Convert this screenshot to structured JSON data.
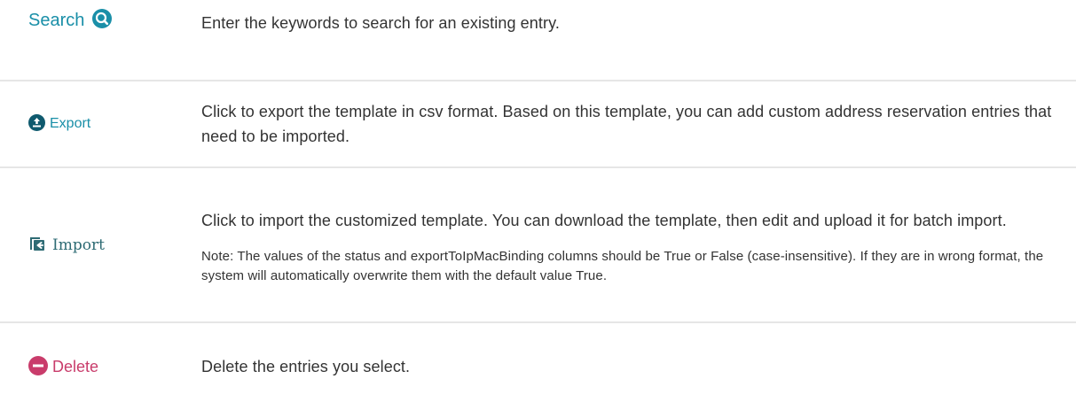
{
  "rows": [
    {
      "control_label": "Search",
      "icon": "search-icon",
      "description": "Enter the keywords to search for an existing entry."
    },
    {
      "control_label": "Export",
      "icon": "export-icon",
      "description": "Click to export the template in csv format. Based on this template, you can add custom address reservation entries that need to be imported."
    },
    {
      "control_label": "Import",
      "icon": "import-icon",
      "description": "Click to import the customized template. You can download the template, then edit and upload it for batch import.",
      "note": "Note: The values of the status and exportToIpMacBinding columns should be True or False (case-insensitive). If they are in wrong format, the system will automatically overwrite them with the default value True."
    },
    {
      "control_label": "Delete",
      "icon": "delete-icon",
      "description": "Delete the entries you select."
    }
  ],
  "colors": {
    "search": "#1a8fa8",
    "export_icon": "#0f5a6e",
    "import_icon": "#2e6b74",
    "delete": "#c93c6b",
    "divider": "#e6e6e6"
  }
}
